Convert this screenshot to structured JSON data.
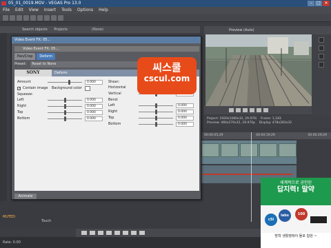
{
  "window": {
    "title": "05_01_0019.MOV - VEGAS Pro 13.0"
  },
  "menu": [
    "File",
    "Edit",
    "View",
    "Insert",
    "Tools",
    "Options",
    "Help"
  ],
  "explorer": {
    "tab_label": "Projects",
    "search_placeholder": "Search objects",
    "dropdown": "(None)"
  },
  "preview": {
    "mode": "Preview (Auto)",
    "project_label": "Project:",
    "project_value": "1920x1080x32, 29.970i",
    "preview_label": "Preview:",
    "preview_value": "480x270x32, 29.970p",
    "frame_label": "Frame:",
    "frame_value": "1,183",
    "display_label": "Display:",
    "display_value": "478x283x32"
  },
  "timeline": {
    "ticks": [
      "00:00:05;29",
      "00:00:19;29",
      "00:00:29;29"
    ]
  },
  "fx": {
    "title": "Video Event FX: 05...",
    "chain": "Video Event FX: 05...",
    "tabs": [
      "Pan/Crop",
      "Deform"
    ],
    "preset_label": "Preset:",
    "preset_value": "Reset to None",
    "logo": "SONY",
    "plugin_name": "Deform",
    "left": {
      "amount_label": "Amount",
      "amount_value": "0.000",
      "contain_label": "Contain image",
      "bg_label": "Background color",
      "squeeze_title": "Squeeze:",
      "rows": [
        {
          "label": "Left",
          "value": "0.000"
        },
        {
          "label": "Right",
          "value": "0.000"
        },
        {
          "label": "Top",
          "value": "0.000"
        },
        {
          "label": "Bottom",
          "value": "0.000"
        }
      ]
    },
    "right": {
      "shear_title": "Shear:",
      "horizontal_label": "Horizontal",
      "horizontal_value": "0.000",
      "vertical_label": "Vertical",
      "vertical_value": "0.000",
      "bend_title": "Bend:",
      "rows": [
        {
          "label": "Left",
          "value": "0.000"
        },
        {
          "label": "Right",
          "value": "0.000"
        },
        {
          "label": "Top",
          "value": "0.000"
        },
        {
          "label": "Bottom",
          "value": "0.000"
        }
      ]
    },
    "animate_label": "Animate"
  },
  "watermark": {
    "line1": "씨스쿨",
    "line2": "cscul.com"
  },
  "tracks": {
    "main_label": "MUTED",
    "touch_label": "Touch"
  },
  "status": {
    "rate": "Rate: 0.00"
  },
  "ad": {
    "line1": "세계적으로 공인된",
    "line2": "답지력! 말약",
    "badge1": "c5l",
    "badge2": "labs",
    "badge3": "100",
    "bottom": "방학 생활영레이 돌포 합원 ~"
  },
  "colors": {
    "accent": "#4a7ab8",
    "watermark": "#e84b1a",
    "ad_green": "#0e7a3e"
  }
}
